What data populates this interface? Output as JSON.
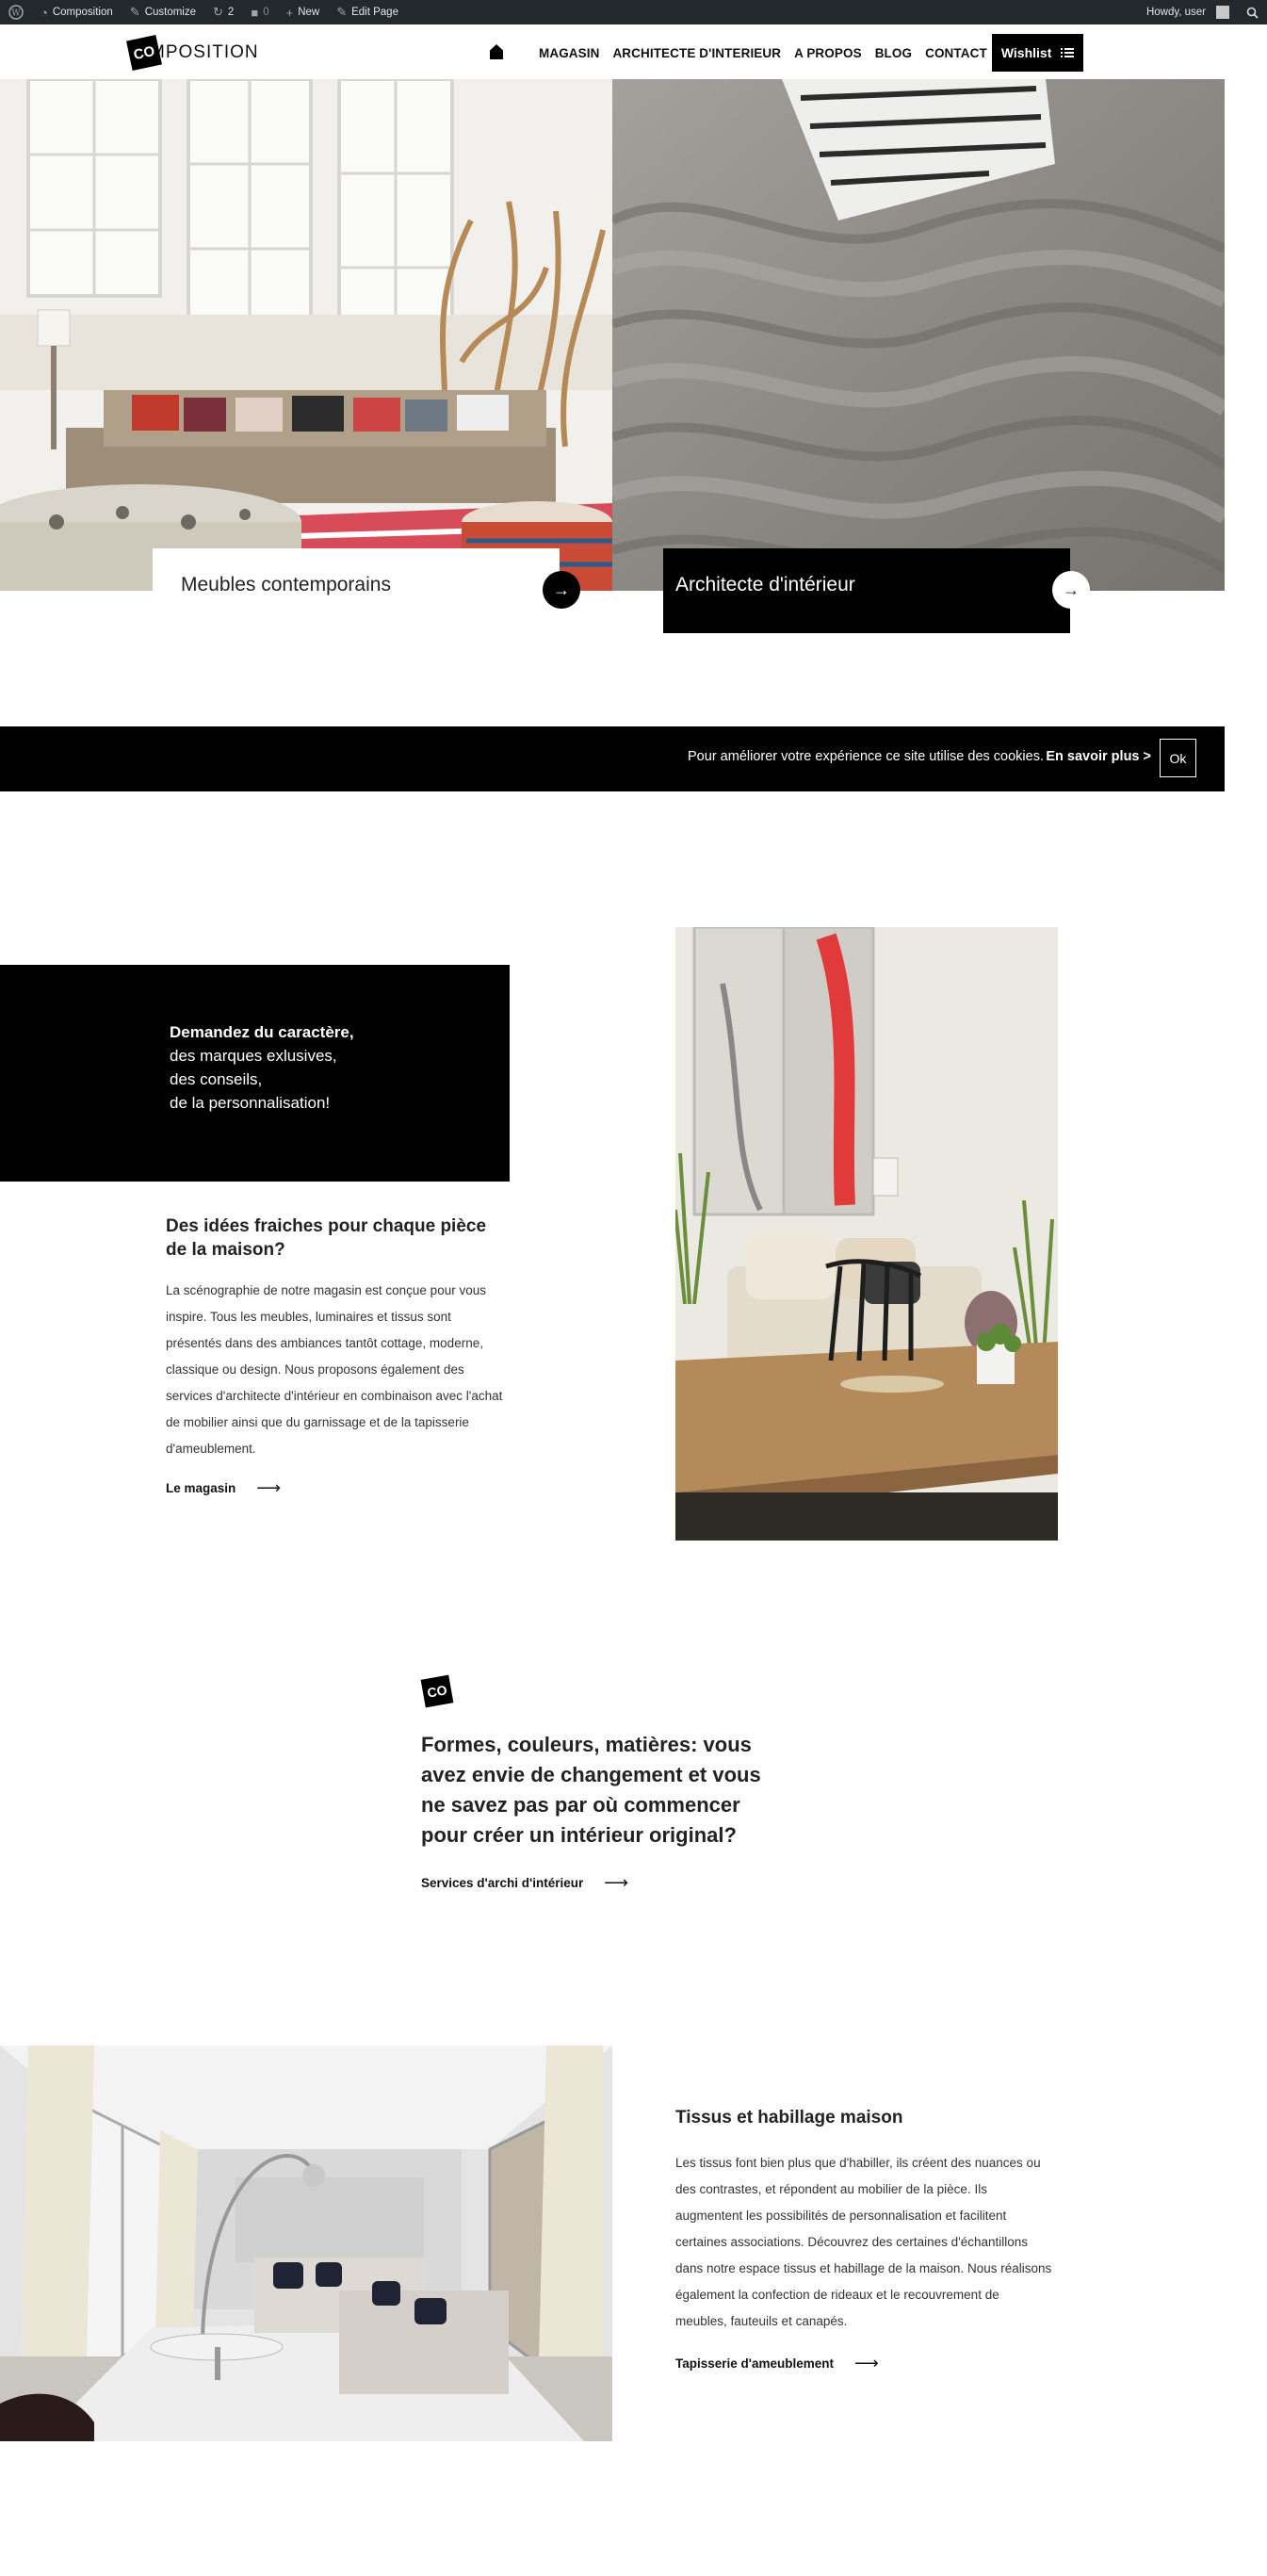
{
  "adminbar": {
    "site_name": "Composition",
    "customize": "Customize",
    "updates_count": "2",
    "comments_count": "0",
    "new_label": "New",
    "edit_page": "Edit Page",
    "howdy": "Howdy, user"
  },
  "header": {
    "logo_mark": "CO",
    "logo_text": "MPOSITION",
    "nav": [
      "MAGASIN",
      "ARCHITECTE D'INTERIEUR",
      "A PROPOS",
      "BLOG",
      "CONTACT"
    ],
    "wishlist": "Wishlist"
  },
  "hero": {
    "card_left": "Meubles contemporains",
    "card_right": "Architecte d'intérieur",
    "arrow": "→"
  },
  "cookie": {
    "message": "Pour améliorer votre expérience ce site utilise des cookies.",
    "more": "En savoir plus >",
    "ok": "Ok"
  },
  "section_store": {
    "box_lines": [
      "Demandez du caractère,",
      "des marques exlusives,",
      "des conseils,",
      "de la personnalisation!"
    ],
    "title": "Des idées fraiches pour chaque pièce de la maison?",
    "body": "La scénographie de notre magasin est conçue pour vous inspire. Tous les meubles, luminaires et tissus sont présentés dans des ambiances tantôt cottage, moderne, classique ou design. Nous proposons également des services d'architecte d'intérieur en combinaison avec l'achat de mobilier ainsi que du garnissage et de la tapisserie d'ameublement.",
    "link": "Le magasin",
    "arrow": "⟶"
  },
  "section_archi": {
    "mark": "CO",
    "title": "Formes, couleurs, matières: vous avez envie de changement et vous ne savez pas par où commencer pour créer un intérieur original?",
    "link": "Services d'archi d'intérieur",
    "arrow": "⟶"
  },
  "section_fabric": {
    "title": "Tissus et habillage maison",
    "body": "Les tissus font bien plus que d'habiller, ils créent des nuances ou des contrastes, et répondent au mobilier de la pièce. Ils augmentent les possibilités de personnalisation et facilitent certaines associations. Découvrez des certaines d'échantillons dans notre espace tissus et habillage de la maison. Nous réalisons également la confection de rideaux et le recouvrement de meubles, fauteuils et canapés.",
    "link": "Tapisserie d'ameublement",
    "arrow": "⟶"
  }
}
